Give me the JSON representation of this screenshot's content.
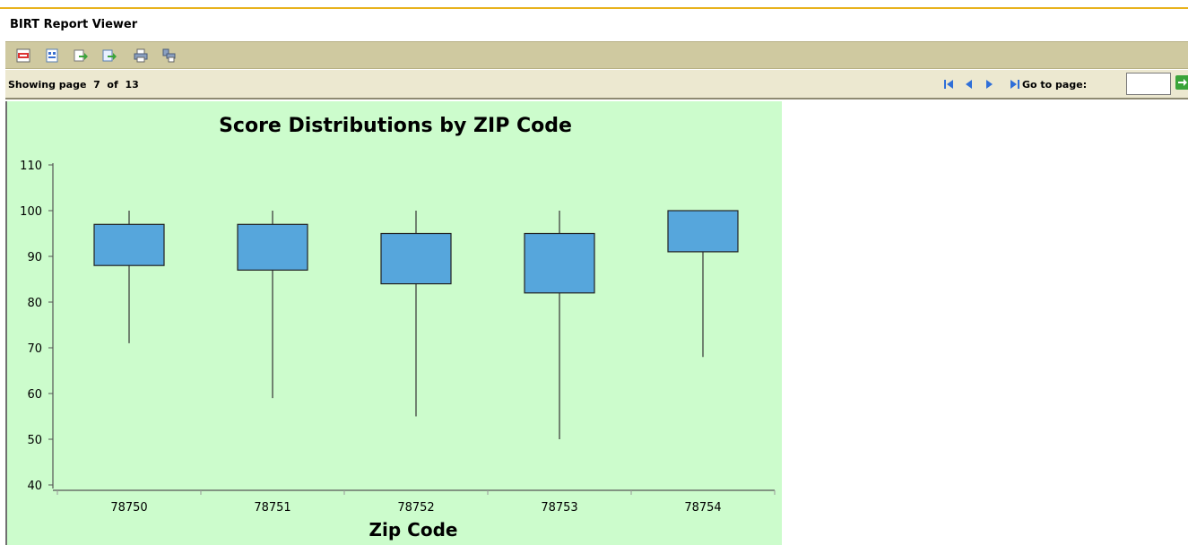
{
  "app": {
    "title": "BIRT Report Viewer"
  },
  "toolbar": {
    "buttons": [
      {
        "name": "toc-icon",
        "tooltip": "TOC"
      },
      {
        "name": "parameters-icon",
        "tooltip": "Parameters"
      },
      {
        "name": "export-data-icon",
        "tooltip": "Export data"
      },
      {
        "name": "export-report-icon",
        "tooltip": "Export report"
      },
      {
        "name": "print-icon",
        "tooltip": "Print"
      },
      {
        "name": "print-server-icon",
        "tooltip": "Print on server"
      }
    ]
  },
  "navigation": {
    "showing_prefix": "Showing page",
    "current_page": "7",
    "of_label": "of",
    "total_pages": "13",
    "goto_label": "Go to page:",
    "goto_value": ""
  },
  "colors": {
    "chart_bg": "#ccfccc",
    "box_fill": "#56a6dc",
    "toolbar_bg": "#cfc9a0",
    "nav_bg": "#ece8d0",
    "accent": "#e8b21c"
  },
  "chart_data": {
    "type": "boxplot",
    "title": "Score Distributions by ZIP Code",
    "xlabel": "Zip Code",
    "ylabel": "",
    "ylim": [
      40,
      110
    ],
    "yticks": [
      40,
      50,
      60,
      70,
      80,
      90,
      100,
      110
    ],
    "categories": [
      "78750",
      "78751",
      "78752",
      "78753",
      "78754"
    ],
    "boxes": [
      {
        "category": "78750",
        "min": 71,
        "q1": 88,
        "q3": 97,
        "max": 100
      },
      {
        "category": "78751",
        "min": 59,
        "q1": 87,
        "q3": 97,
        "max": 100
      },
      {
        "category": "78752",
        "min": 55,
        "q1": 84,
        "q3": 95,
        "max": 100
      },
      {
        "category": "78753",
        "min": 50,
        "q1": 82,
        "q3": 95,
        "max": 100
      },
      {
        "category": "78754",
        "min": 68,
        "q1": 91,
        "q3": 100,
        "max": 100
      }
    ],
    "grid": false,
    "legend": "none"
  }
}
